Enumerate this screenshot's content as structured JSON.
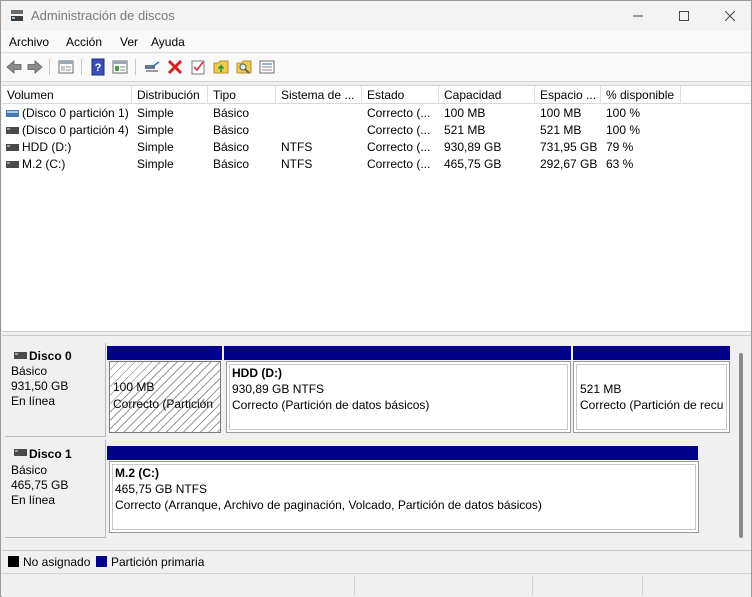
{
  "window": {
    "title": "Administración de discos"
  },
  "menu": [
    "Archivo",
    "Acción",
    "Ver",
    "Ayuda"
  ],
  "toolbar": {
    "icons": [
      "back-arrow-icon",
      "forward-arrow-icon",
      "properties-icon",
      "help-icon",
      "view-icon",
      "connect-disk-icon",
      "delete-icon",
      "check-icon",
      "folder-up-icon",
      "search-folder-icon",
      "list-icon"
    ]
  },
  "volume_list": {
    "columns": [
      "Volumen",
      "Distribución",
      "Tipo",
      "Sistema de ...",
      "Estado",
      "Capacidad",
      "Espacio ...",
      "% disponible"
    ],
    "rows": [
      [
        "(Disco 0 partición 1)",
        "Simple",
        "Básico",
        "",
        "Correcto (...",
        "100 MB",
        "100 MB",
        "100 %"
      ],
      [
        "(Disco 0 partición 4)",
        "Simple",
        "Básico",
        "",
        "Correcto (...",
        "521 MB",
        "521 MB",
        "100 %"
      ],
      [
        "HDD (D:)",
        "Simple",
        "Básico",
        "NTFS",
        "Correcto (...",
        "930,89 GB",
        "731,95 GB",
        "79 %"
      ],
      [
        "M.2 (C:)",
        "Simple",
        "Básico",
        "NTFS",
        "Correcto (...",
        "465,75 GB",
        "292,67 GB",
        "63 %"
      ]
    ]
  },
  "disks": [
    {
      "name": "Disco 0",
      "type": "Básico",
      "size": "931,50 GB",
      "status": "En línea",
      "partitions": [
        {
          "title": "",
          "size": "100 MB",
          "status": "Correcto (Partición"
        },
        {
          "title": "HDD  (D:)",
          "size": "930,89 GB NTFS",
          "status": "Correcto (Partición de datos básicos)"
        },
        {
          "title": "",
          "size": "521 MB",
          "status": "Correcto (Partición de recu"
        }
      ]
    },
    {
      "name": "Disco 1",
      "type": "Básico",
      "size": "465,75 GB",
      "status": "En línea",
      "partitions": [
        {
          "title": "M.2  (C:)",
          "size": "465,75 GB NTFS",
          "status": "Correcto (Arranque, Archivo de paginación, Volcado, Partición de datos básicos)"
        }
      ]
    }
  ],
  "legend": [
    {
      "label": "No asignado",
      "color": "#000000"
    },
    {
      "label": "Partición primaria",
      "color": "#00008b"
    }
  ]
}
